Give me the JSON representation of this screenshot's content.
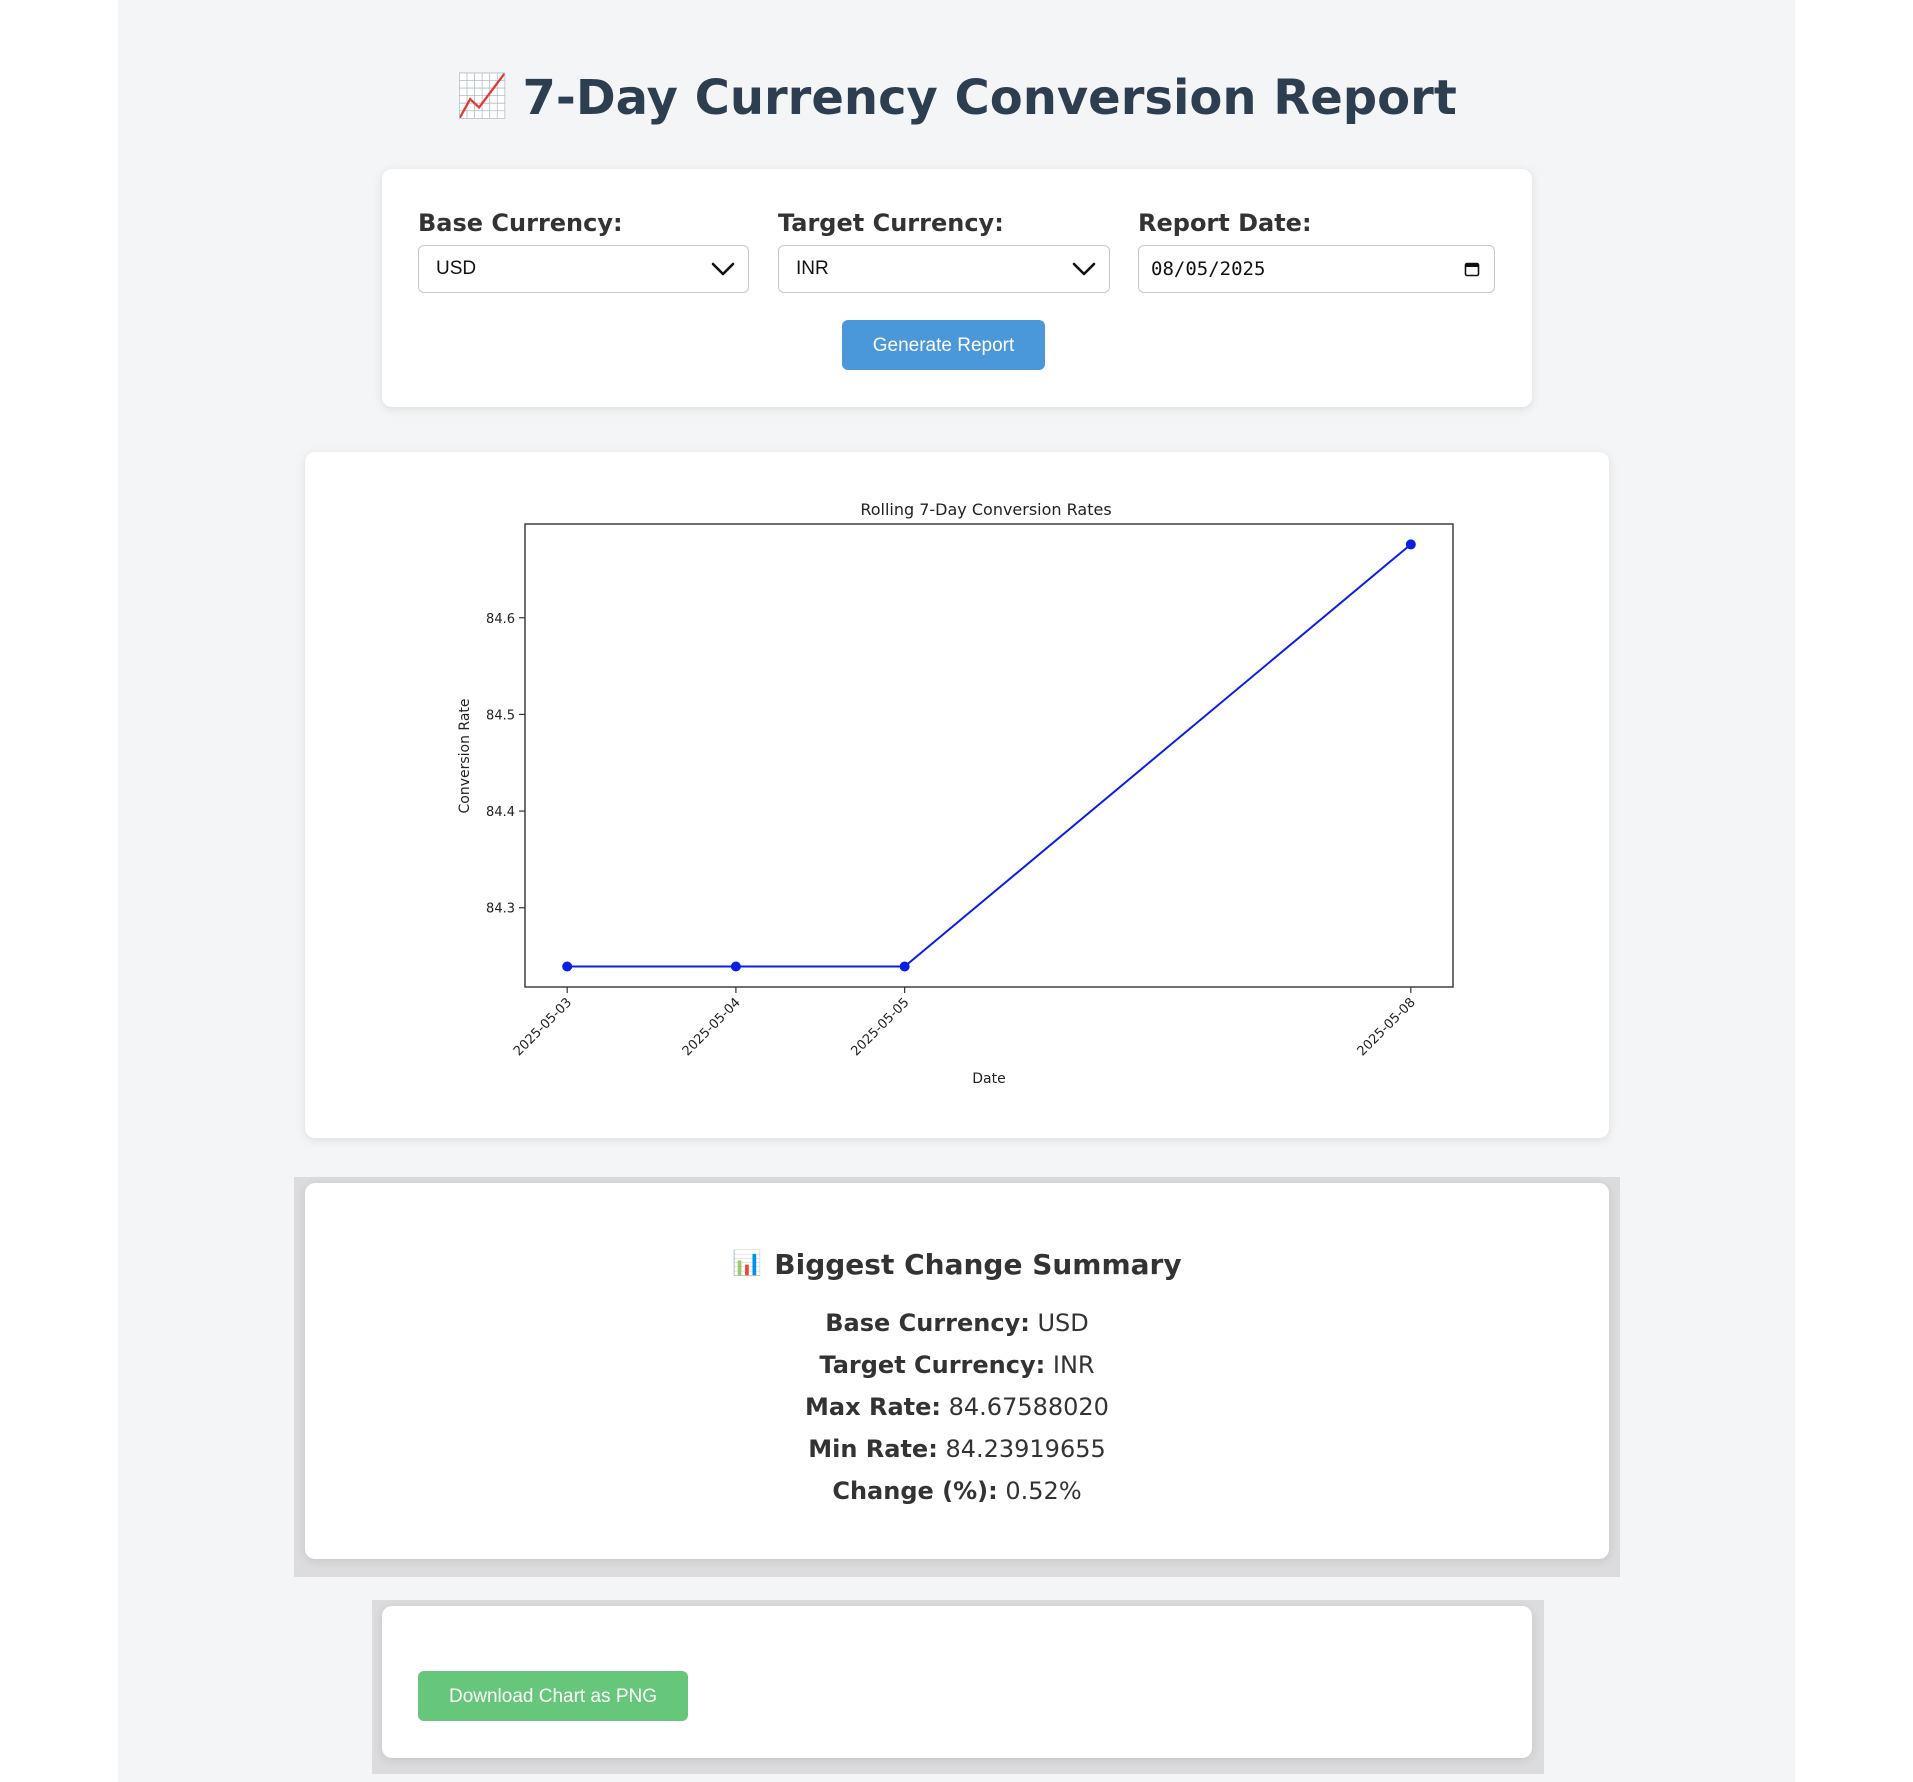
{
  "header": {
    "title": "7-Day Currency Conversion Report",
    "title_icon": "chart-increasing-icon",
    "title_emoji": "📈"
  },
  "form": {
    "base_label": "Base Currency:",
    "base_value": "USD",
    "target_label": "Target Currency:",
    "target_value": "INR",
    "date_label": "Report Date:",
    "date_value": "08/05/2025",
    "generate_label": "Generate Report",
    "generate_color": "#4a98da"
  },
  "chart_data": {
    "type": "line",
    "title": "Rolling 7-Day Conversion Rates",
    "xlabel": "Date",
    "ylabel": "Conversion Rate",
    "x": [
      "2025-05-03",
      "2025-05-04",
      "2025-05-05",
      "2025-05-08"
    ],
    "y": [
      84.23919655,
      84.23919655,
      84.23919655,
      84.6758802
    ],
    "yticks": [
      "84.3",
      "84.4",
      "84.5",
      "84.6"
    ],
    "xticks": [
      "2025-05-03",
      "2025-05-04",
      "2025-05-05",
      "2025-05-08"
    ],
    "ylim": [
      84.218,
      84.697
    ],
    "xlim": [
      "2025-05-02 18:00",
      "2025-05-08 06:00"
    ],
    "line_color": "#0a1fe6",
    "grid": false,
    "legend": "none"
  },
  "summary": {
    "title": "Biggest Change Summary",
    "title_icon": "bar-chart-icon",
    "title_emoji": "📊",
    "base_label": "Base Currency:",
    "base_value": "USD",
    "target_label": "Target Currency:",
    "target_value": "INR",
    "max_label": "Max Rate:",
    "max_value": "84.67588020",
    "min_label": "Min Rate:",
    "min_value": "84.23919655",
    "change_label": "Change (%):",
    "change_value": "0.52%"
  },
  "download": {
    "label": "Download Chart as PNG",
    "color": "#66c77a"
  }
}
